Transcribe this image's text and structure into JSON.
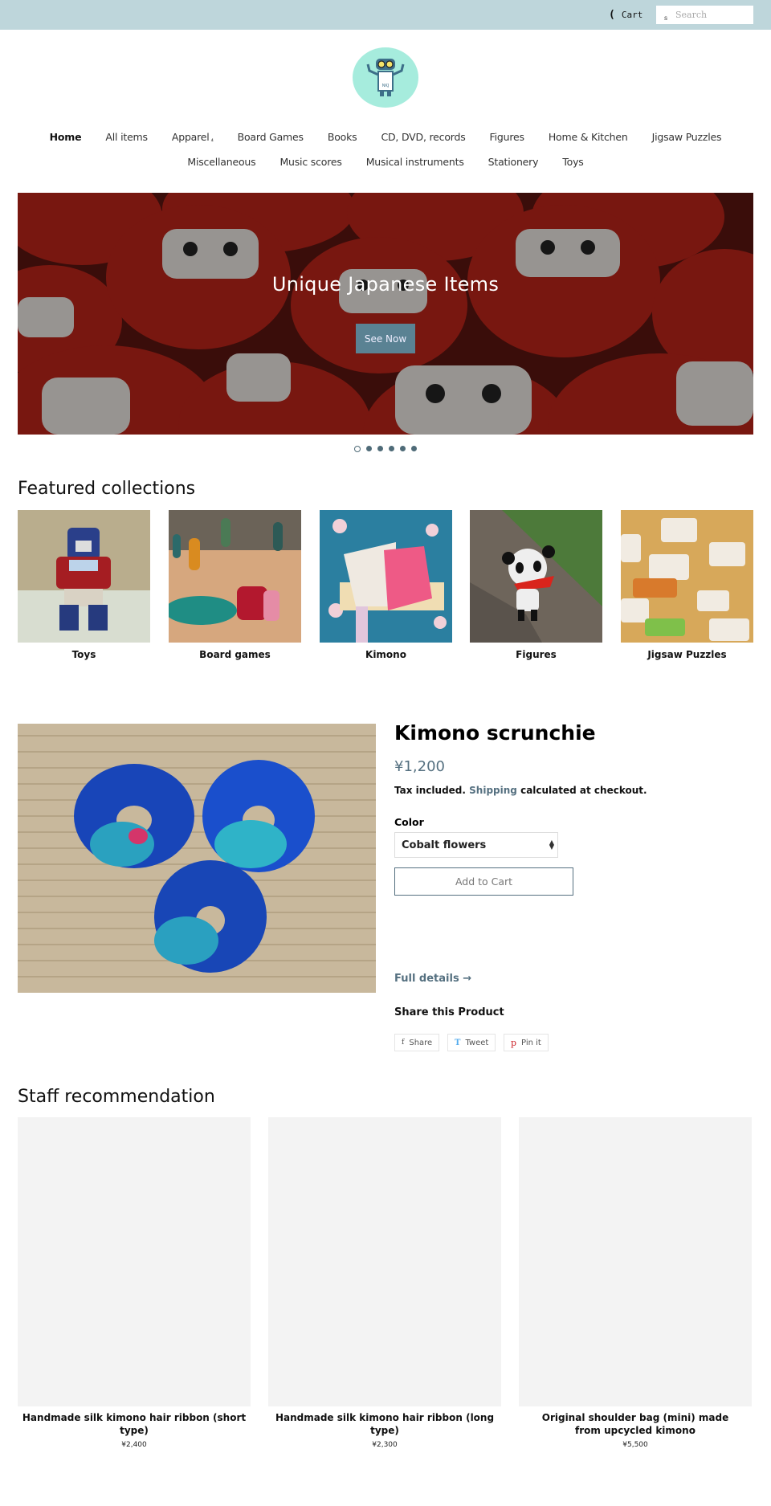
{
  "topbar": {
    "cart_label": "Cart",
    "cart_icon": "(",
    "search_icon": "s",
    "search_placeholder": "Search"
  },
  "nav": {
    "row1": [
      {
        "label": "Home",
        "active": true
      },
      {
        "label": "All items"
      },
      {
        "label": "Apparel",
        "caret": "₄"
      },
      {
        "label": "Board Games"
      },
      {
        "label": "Books"
      },
      {
        "label": "CD, DVD, records"
      },
      {
        "label": "Figures"
      },
      {
        "label": "Home & Kitchen"
      },
      {
        "label": "Jigsaw Puzzles"
      }
    ],
    "row2": [
      {
        "label": "Miscellaneous"
      },
      {
        "label": "Music scores"
      },
      {
        "label": "Musical instruments"
      },
      {
        "label": "Stationery"
      },
      {
        "label": "Toys"
      }
    ]
  },
  "hero": {
    "title": "Unique Japanese Items",
    "button_label": "See Now",
    "slide_count": 6,
    "active_slide": 1
  },
  "featured": {
    "title": "Featured collections",
    "collections": [
      {
        "label": "Toys"
      },
      {
        "label": "Board games"
      },
      {
        "label": "Kimono"
      },
      {
        "label": "Figures"
      },
      {
        "label": "Jigsaw Puzzles"
      }
    ]
  },
  "product": {
    "title": "Kimono scrunchie",
    "price": "¥1,200",
    "tax_prefix": "Tax included.",
    "shipping_link": "Shipping",
    "tax_suffix": "calculated at checkout.",
    "color_label": "Color",
    "color_value": "Cobalt flowers",
    "add_to_cart": "Add to Cart",
    "full_details": "Full details →",
    "share_title": "Share this Product",
    "share_buttons": [
      {
        "icon": "f",
        "label": "Share"
      },
      {
        "icon": "T",
        "label": "Tweet"
      },
      {
        "icon": "p",
        "label": "Pin it"
      }
    ]
  },
  "staff": {
    "title": "Staff recommendation",
    "items": [
      {
        "name": "Handmade silk kimono hair ribbon (short type)",
        "price": "¥2,400"
      },
      {
        "name": "Handmade silk kimono hair ribbon (long type)",
        "price": "¥2,300"
      },
      {
        "name": "Original shoulder bag (mini) made from upcycled kimono",
        "price": "¥5,500"
      }
    ]
  },
  "colors": {
    "topbar": "#bed6db",
    "accent": "#557080",
    "hero_button": "#5a8293"
  }
}
